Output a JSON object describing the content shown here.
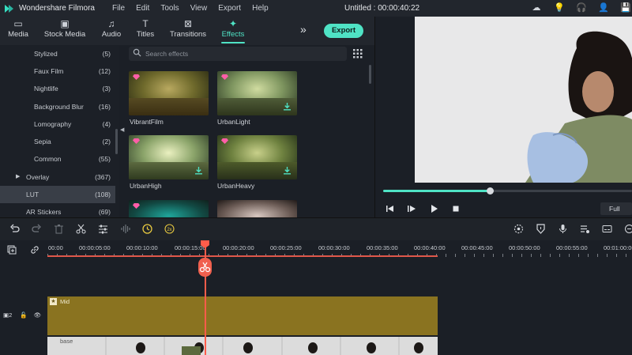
{
  "app": {
    "name": "Wondershare Filmora",
    "doc_title": "Untitled : 00:00:40:22"
  },
  "menu": [
    "File",
    "Edit",
    "Tools",
    "View",
    "Export",
    "Help"
  ],
  "toolbar": {
    "tabs": [
      {
        "label": "Media",
        "icon": "folder-icon"
      },
      {
        "label": "Stock Media",
        "icon": "image-icon"
      },
      {
        "label": "Audio",
        "icon": "music-note-icon"
      },
      {
        "label": "Titles",
        "icon": "text-icon"
      },
      {
        "label": "Transitions",
        "icon": "transition-icon"
      },
      {
        "label": "Effects",
        "icon": "effects-icon",
        "active": true
      }
    ],
    "export_label": "Export"
  },
  "categories": [
    {
      "label": "Stylized",
      "count": "(5)"
    },
    {
      "label": "Faux Film",
      "count": "(12)"
    },
    {
      "label": "Nightlife",
      "count": "(3)"
    },
    {
      "label": "Background Blur",
      "count": "(16)"
    },
    {
      "label": "Lomography",
      "count": "(4)"
    },
    {
      "label": "Sepia",
      "count": "(2)"
    },
    {
      "label": "Common",
      "count": "(55)"
    },
    {
      "label": "Overlay",
      "count": "(367)"
    },
    {
      "label": "LUT",
      "count": "(108)",
      "active": true
    },
    {
      "label": "AR Stickers",
      "count": "(69)"
    }
  ],
  "search": {
    "placeholder": "Search effects"
  },
  "effects": [
    {
      "label": "VibrantFilm"
    },
    {
      "label": "UrbanLight"
    },
    {
      "label": "UrbanHigh"
    },
    {
      "label": "UrbanHeavy"
    },
    {
      "label": ""
    },
    {
      "label": ""
    }
  ],
  "preview": {
    "progress": 0.43,
    "quality": "Full"
  },
  "timeline": {
    "ticks": [
      "00:00",
      "00:00:05:00",
      "00:00:10:00",
      "00:00:15:00",
      "00:00:20:00",
      "00:00:25:00",
      "00:00:30:00",
      "00:00:35:00",
      "00:00:40:00",
      "00:00:45:00",
      "00:00:50:00",
      "00:00:55:00",
      "00:01:00:00"
    ],
    "tracks": [
      {
        "label": "Mid"
      },
      {
        "label": "base"
      }
    ],
    "track_number": "2"
  },
  "colors": {
    "accent": "#4fe3c5",
    "playhead": "#ff5c4a",
    "mid_track": "#8a7320"
  }
}
